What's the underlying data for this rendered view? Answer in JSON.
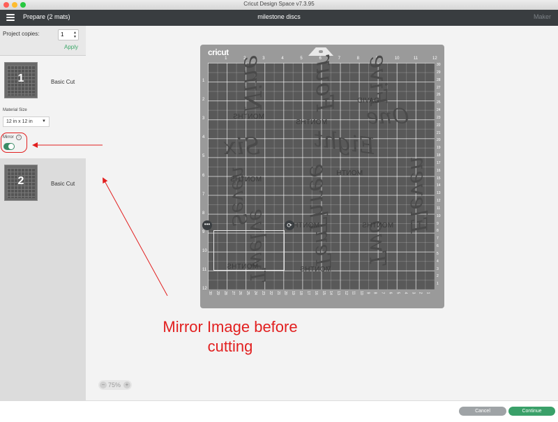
{
  "window": {
    "title": "Cricut Design Space  v7.3.95"
  },
  "header": {
    "prepare_title": "Prepare (2 mats)",
    "project_name": "milestone discs",
    "machine": "Maker"
  },
  "sidebar": {
    "copies_label": "Project copies:",
    "copies_value": "1",
    "apply_label": "Apply",
    "mats": [
      {
        "number": "1",
        "label": "Basic Cut"
      },
      {
        "number": "2",
        "label": "Basic Cut"
      }
    ],
    "material_size_label": "Material Size",
    "material_size_value": "12 in x 12 in",
    "mirror_label": "Mirror",
    "mirror_on": true
  },
  "mat": {
    "brand": "cricut",
    "top_ticks": [
      "1",
      "2",
      "3",
      "4",
      "5",
      "6",
      "7",
      "8",
      "9",
      "10",
      "11",
      "12"
    ],
    "left_ticks": [
      "1",
      "2",
      "3",
      "4",
      "5",
      "6",
      "7",
      "8",
      "9",
      "10",
      "11",
      "12"
    ],
    "right_ticks": [
      "30",
      "29",
      "28",
      "27",
      "26",
      "25",
      "24",
      "23",
      "22",
      "21",
      "20",
      "19",
      "18",
      "17",
      "16",
      "15",
      "14",
      "13",
      "12",
      "11",
      "10",
      "9",
      "8",
      "7",
      "6",
      "5",
      "4",
      "3",
      "2",
      "1"
    ],
    "bottom_ticks": [
      "30",
      "29",
      "28",
      "27",
      "26",
      "25",
      "24",
      "23",
      "22",
      "21",
      "20",
      "19",
      "18",
      "17",
      "16",
      "15",
      "14",
      "13",
      "12",
      "11",
      "10",
      "9",
      "8",
      "7",
      "6",
      "5",
      "4",
      "3",
      "2",
      "1"
    ],
    "design_script": [
      "Nine",
      "Four",
      "Five",
      "One",
      "Eight",
      "Six",
      "Seven",
      "Three",
      "Two",
      "Twelve",
      "Ten",
      "Eleven"
    ],
    "design_caps": [
      "DAVID",
      "MONTHS",
      "MONTHS",
      "MONTH",
      "MONTHS",
      "MONTHS",
      "MONTHS",
      "MONTHS",
      "MONTHS"
    ]
  },
  "annotation": {
    "line1": "Mirror Image before",
    "line2": "cutting"
  },
  "zoom": {
    "minus": "−",
    "value": "75%",
    "plus": "+"
  },
  "footer": {
    "cancel_label": "Cancel",
    "continue_label": "Continue"
  },
  "colors": {
    "header_bg": "#393d40",
    "accent_green": "#3aa069",
    "annotation_red": "#e21f1f",
    "mat_gray": "#9a9a9a"
  }
}
